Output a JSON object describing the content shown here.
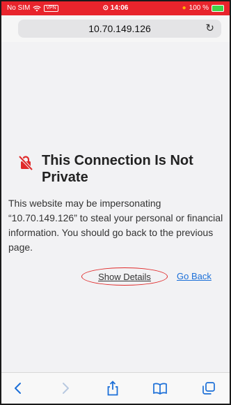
{
  "status_bar": {
    "carrier": "No SIM",
    "vpn_label": "VPN",
    "time": "14:06",
    "battery": "100 %"
  },
  "address_bar": {
    "url": "10.70.149.126"
  },
  "warning": {
    "title": "This Connection Is Not Private",
    "message": "This website may be impersonating “10.70.149.126” to steal your personal or financial information. You should go back to the previous page.",
    "show_details_label": "Show Details",
    "go_back_label": "Go Back"
  },
  "toolbar": {
    "icons": [
      "back-icon",
      "forward-icon",
      "share-icon",
      "bookmarks-icon",
      "tabs-icon"
    ]
  },
  "colors": {
    "status_bar": "#e8242c",
    "link": "#1b6fd8",
    "warning_icon": "#e02a2a",
    "toolbar_icons": "#1b6fd8"
  }
}
